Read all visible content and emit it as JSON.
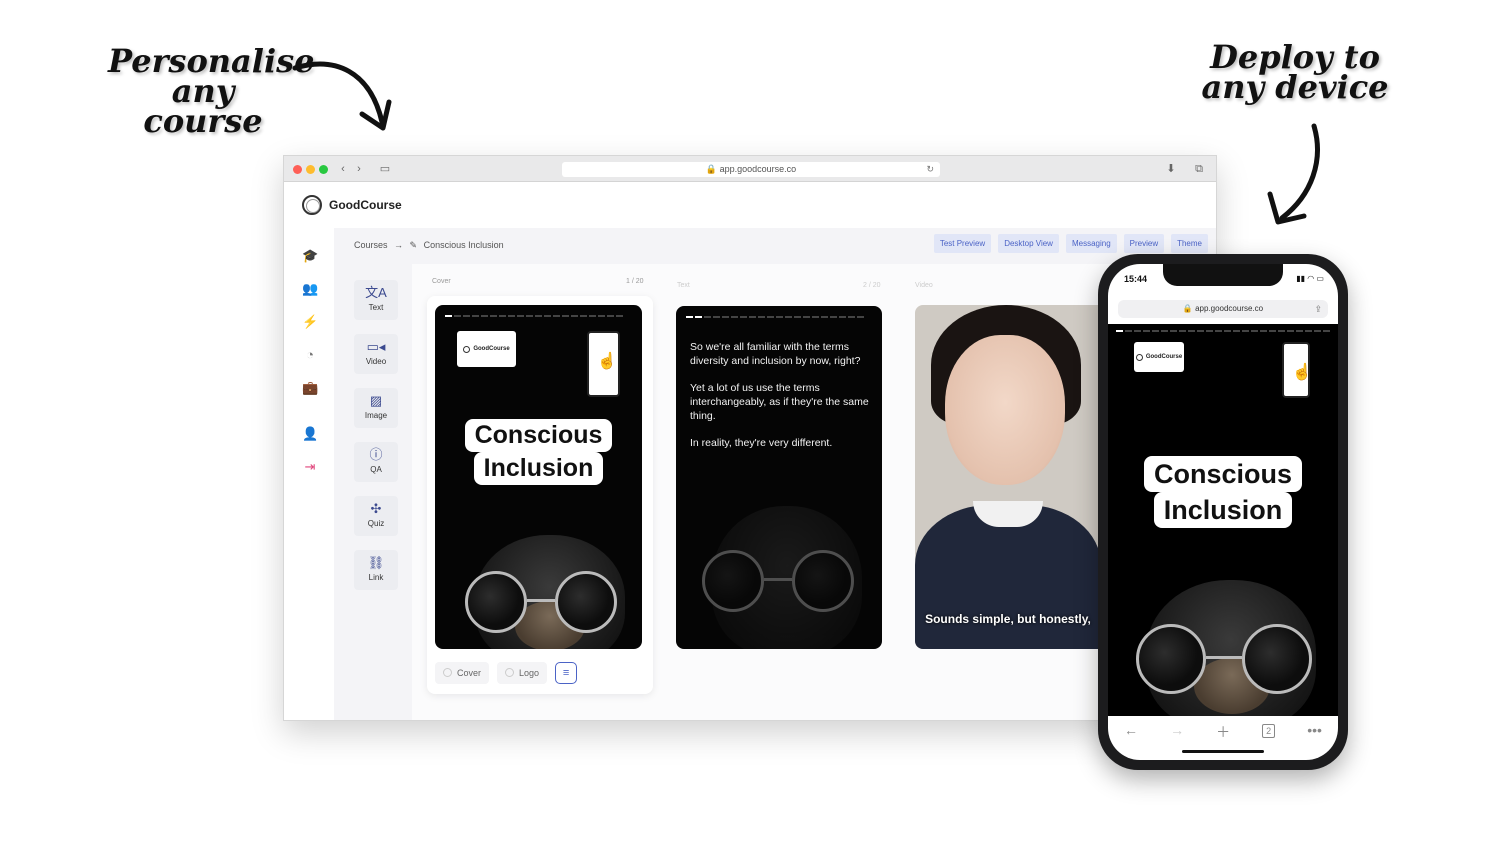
{
  "captions": {
    "left": "Personalise any course",
    "right": "Deploy to any device"
  },
  "browser": {
    "url": "app.goodcourse.co"
  },
  "app": {
    "brand": "GoodCourse",
    "breadcrumb": {
      "root": "Courses",
      "separator": "→",
      "current": "Conscious Inclusion"
    },
    "top_tabs": [
      "Test Preview",
      "Desktop View",
      "Messaging",
      "Preview",
      "Theme"
    ],
    "tools": [
      {
        "label": "Text",
        "icon": "translate-icon"
      },
      {
        "label": "Video",
        "icon": "video-icon"
      },
      {
        "label": "Image",
        "icon": "image-icon"
      },
      {
        "label": "QA",
        "icon": "question-icon"
      },
      {
        "label": "Quiz",
        "icon": "puzzle-icon"
      },
      {
        "label": "Link",
        "icon": "link-icon"
      }
    ],
    "slides": [
      {
        "type_label": "Cover",
        "count": "1 / 20"
      },
      {
        "type_label": "Text",
        "count": "2 / 20"
      },
      {
        "type_label": "Video",
        "count": ""
      }
    ],
    "cover": {
      "logo_text": "GoodCourse",
      "title_line1": "Conscious",
      "title_line2": "Inclusion"
    },
    "text_slide": {
      "p1": "So we're all familiar with the terms diversity and inclusion by now, right?",
      "p2": "Yet a lot of us use the terms interchangeably, as if they're the same thing.",
      "p3": "In reality, they're very different."
    },
    "video_slide": {
      "subtitle": "Sounds simple, but honestly,"
    },
    "bottom_bar": {
      "cover": "Cover",
      "logo": "Logo"
    }
  },
  "phone": {
    "time": "15:44",
    "url": "app.goodcourse.co",
    "logo_text": "GoodCourse",
    "title_line1": "Conscious",
    "title_line2": "Inclusion",
    "tabs_count": "2"
  },
  "colors": {
    "accent": "#4b63c6",
    "tab_bg": "#e1e6f7",
    "logout": "#e0457b"
  }
}
